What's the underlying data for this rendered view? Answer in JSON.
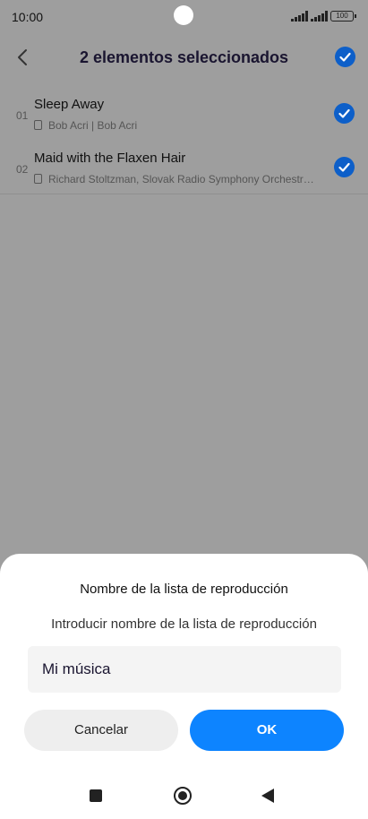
{
  "status_bar": {
    "time": "10:00",
    "battery": "100"
  },
  "header": {
    "title": "2 elementos seleccionados",
    "back_icon": "chevron-left-icon",
    "select_all_icon": "check-circle-icon"
  },
  "songs": [
    {
      "number": "01",
      "title": "Sleep Away",
      "subtitle": "Bob Acri | Bob Acri",
      "selected": true
    },
    {
      "number": "02",
      "title": "Maid with the Flaxen Hair",
      "subtitle": "Richard Stoltzman, Slovak Radio Symphony Orchestr…",
      "selected": true
    }
  ],
  "dialog": {
    "title": "Nombre de la lista de reproducción",
    "hint": "Introducir nombre de la lista de reproducción",
    "input_value": "Mi música",
    "cancel_label": "Cancelar",
    "ok_label": "OK"
  },
  "navigation": {
    "recents_icon": "square-icon",
    "home_icon": "circle-home-icon",
    "back_icon": "triangle-back-icon"
  },
  "colors": {
    "accent": "#0d84ff",
    "check": "#0d5fc9",
    "scrim": "#9e9e9e"
  }
}
